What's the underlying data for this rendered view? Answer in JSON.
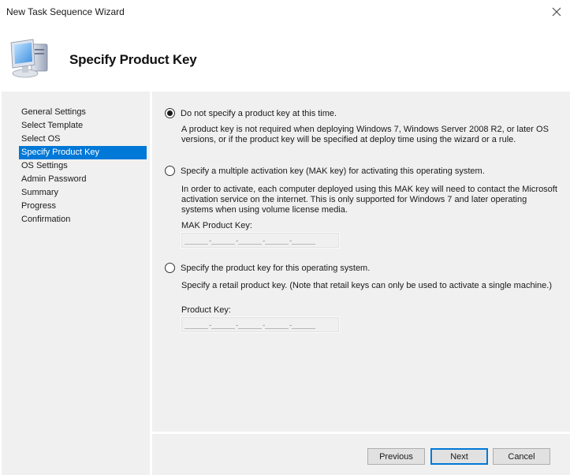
{
  "window": {
    "title": "New Task Sequence Wizard",
    "close_icon": "close-icon"
  },
  "header": {
    "icon": "computer-icon",
    "heading": "Specify Product Key"
  },
  "sidebar": {
    "items": [
      {
        "label": "General Settings",
        "active": false
      },
      {
        "label": "Select Template",
        "active": false
      },
      {
        "label": "Select OS",
        "active": false
      },
      {
        "label": "Specify Product Key",
        "active": true
      },
      {
        "label": "OS Settings",
        "active": false
      },
      {
        "label": "Admin Password",
        "active": false
      },
      {
        "label": "Summary",
        "active": false
      },
      {
        "label": "Progress",
        "active": false
      },
      {
        "label": "Confirmation",
        "active": false
      }
    ],
    "accent": "#0078d7"
  },
  "options": {
    "no_key": {
      "label": "Do not specify a product key at this time.",
      "selected": true,
      "description": "A product key is not required when deploying Windows 7, Windows Server 2008 R2, or later OS versions, or if the product key will be specified at deploy time using the wizard or a rule."
    },
    "mak_key": {
      "label": "Specify a multiple activation key (MAK key) for activating this operating system.",
      "selected": false,
      "description": "In order to activate, each computer deployed using this MAK key will need to contact the Microsoft activation service on the internet.  This is only supported for Windows 7 and later operating systems when using volume license media.",
      "field_label": "MAK Product Key:",
      "field_value": "",
      "field_mask": "_____-_____-_____-_____-_____"
    },
    "retail_key": {
      "label": "Specify the product key for this operating system.",
      "selected": false,
      "description": "Specify a retail product key.  (Note that retail keys can only be used to activate a single machine.)",
      "field_label": "Product Key:",
      "field_value": "",
      "field_mask": "_____-_____-_____-_____-_____"
    }
  },
  "buttons": {
    "previous": "Previous",
    "next": "Next",
    "cancel": "Cancel"
  }
}
